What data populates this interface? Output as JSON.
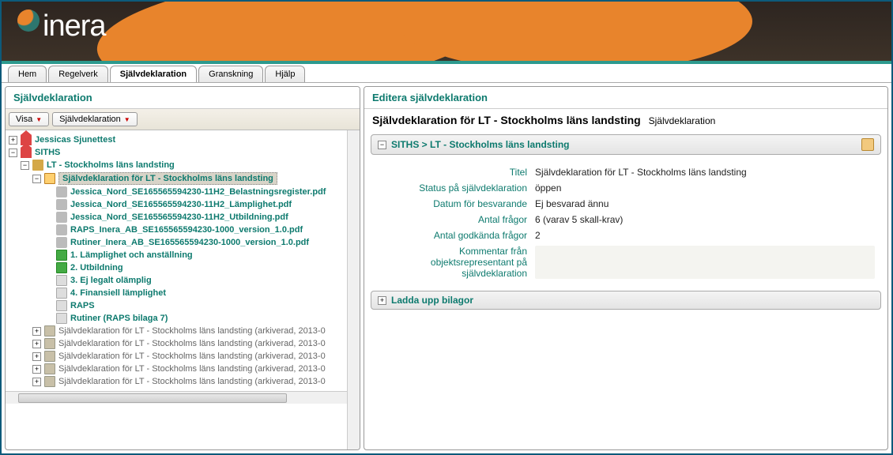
{
  "logo_text": "inera",
  "tabs": [
    {
      "label": "Hem"
    },
    {
      "label": "Regelverk"
    },
    {
      "label": "Självdeklaration",
      "active": true
    },
    {
      "label": "Granskning"
    },
    {
      "label": "Hjälp"
    }
  ],
  "left": {
    "header": "Självdeklaration",
    "toolbar": {
      "visa": "Visa",
      "sjalvdeklaration": "Självdeklaration"
    },
    "tree": {
      "root1": "Jessicas Sjunettest",
      "root2": "SITHS",
      "lt": "LT - Stockholms läns landsting",
      "selected": "Självdeklaration för LT - Stockholms läns landsting",
      "files": [
        "Jessica_Nord_SE165565594230-11H2_Belastningsregister.pdf",
        "Jessica_Nord_SE165565594230-11H2_Lämplighet.pdf",
        "Jessica_Nord_SE165565594230-11H2_Utbildning.pdf",
        "RAPS_Inera_AB_SE165565594230-1000_version_1.0.pdf",
        "Rutiner_Inera_AB_SE165565594230-1000_version_1.0.pdf"
      ],
      "sections": [
        {
          "label": "1. Lämplighet och anställning",
          "green": true
        },
        {
          "label": "2. Utbildning",
          "green": true
        },
        {
          "label": "3. Ej legalt olämplig",
          "green": false
        },
        {
          "label": "4. Finansiell lämplighet",
          "green": false
        },
        {
          "label": "RAPS",
          "green": false
        },
        {
          "label": "Rutiner (RAPS bilaga 7)",
          "green": false
        }
      ],
      "archived": [
        "Självdeklaration för LT - Stockholms läns landsting (arkiverad, 2013-0",
        "Självdeklaration för LT - Stockholms läns landsting (arkiverad, 2013-0",
        "Självdeklaration för LT - Stockholms läns landsting (arkiverad, 2013-0",
        "Självdeklaration för LT - Stockholms läns landsting (arkiverad, 2013-0",
        "Självdeklaration för LT - Stockholms läns landsting (arkiverad, 2013-0"
      ]
    }
  },
  "right": {
    "header": "Editera självdeklaration",
    "title_main": "Självdeklaration för LT - Stockholms läns landsting",
    "title_sub": "Självdeklaration",
    "breadcrumb": "SITHS > LT - Stockholms läns landsting",
    "details": {
      "titel_label": "Titel",
      "titel_value": "Självdeklaration för LT - Stockholms läns landsting",
      "status_label": "Status på självdeklaration",
      "status_value": "öppen",
      "datum_label": "Datum för besvarande",
      "datum_value": "Ej besvarad ännu",
      "antal_label": "Antal frågor",
      "antal_value": "6 (varav 5 skall-krav)",
      "godkanda_label": "Antal godkända frågor",
      "godkanda_value": "2",
      "kommentar_label": "Kommentar från objektsrepresentant på självdeklaration"
    },
    "upload_section": "Ladda upp bilagor"
  }
}
